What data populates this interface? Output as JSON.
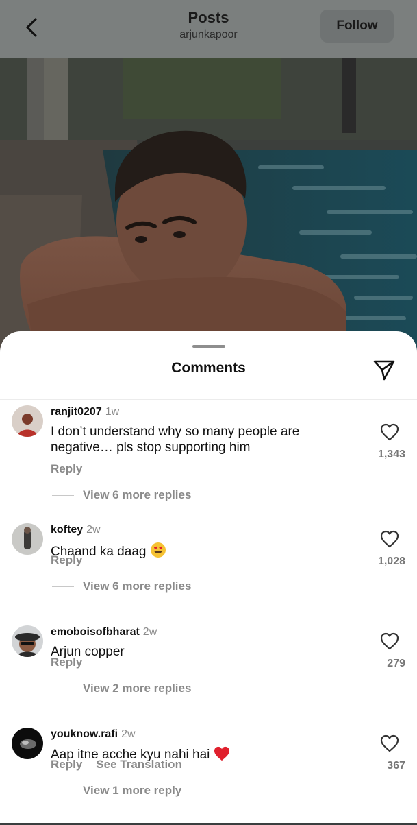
{
  "header": {
    "title": "Posts",
    "subtitle": "arjunkapoor",
    "follow_label": "Follow",
    "back_icon": "chevron-left-icon"
  },
  "sheet": {
    "title": "Comments",
    "share_icon": "paper-plane-icon"
  },
  "comments": [
    {
      "username": "ranjit0207",
      "time": "1w",
      "text": "I don’t understand why so many people are negative… pls stop supporting him",
      "reply_label": "Reply",
      "likes": "1,343",
      "view_replies": "View 6 more replies"
    },
    {
      "username": "koftey",
      "time": "2w",
      "text": "Chaand ka daag",
      "emoji": "heart-eyes-emoji",
      "reply_label": "Reply",
      "likes": "1,028",
      "view_replies": "View 6 more replies"
    },
    {
      "username": "emoboisofbharat",
      "time": "2w",
      "text": "Arjun copper",
      "reply_label": "Reply",
      "likes": "279",
      "view_replies": "View 2 more replies"
    },
    {
      "username": "youknow.rafi",
      "time": "2w",
      "text": "Aap itne acche kyu nahi hai",
      "emoji": "red-heart-emoji",
      "reply_label": "Reply",
      "translation_label": "See Translation",
      "likes": "367",
      "view_replies": "View 1 more reply"
    }
  ],
  "colors": {
    "header_bg": "#7b7f7e",
    "muted_text": "#8a8a8a",
    "heart": "#e0202d"
  }
}
